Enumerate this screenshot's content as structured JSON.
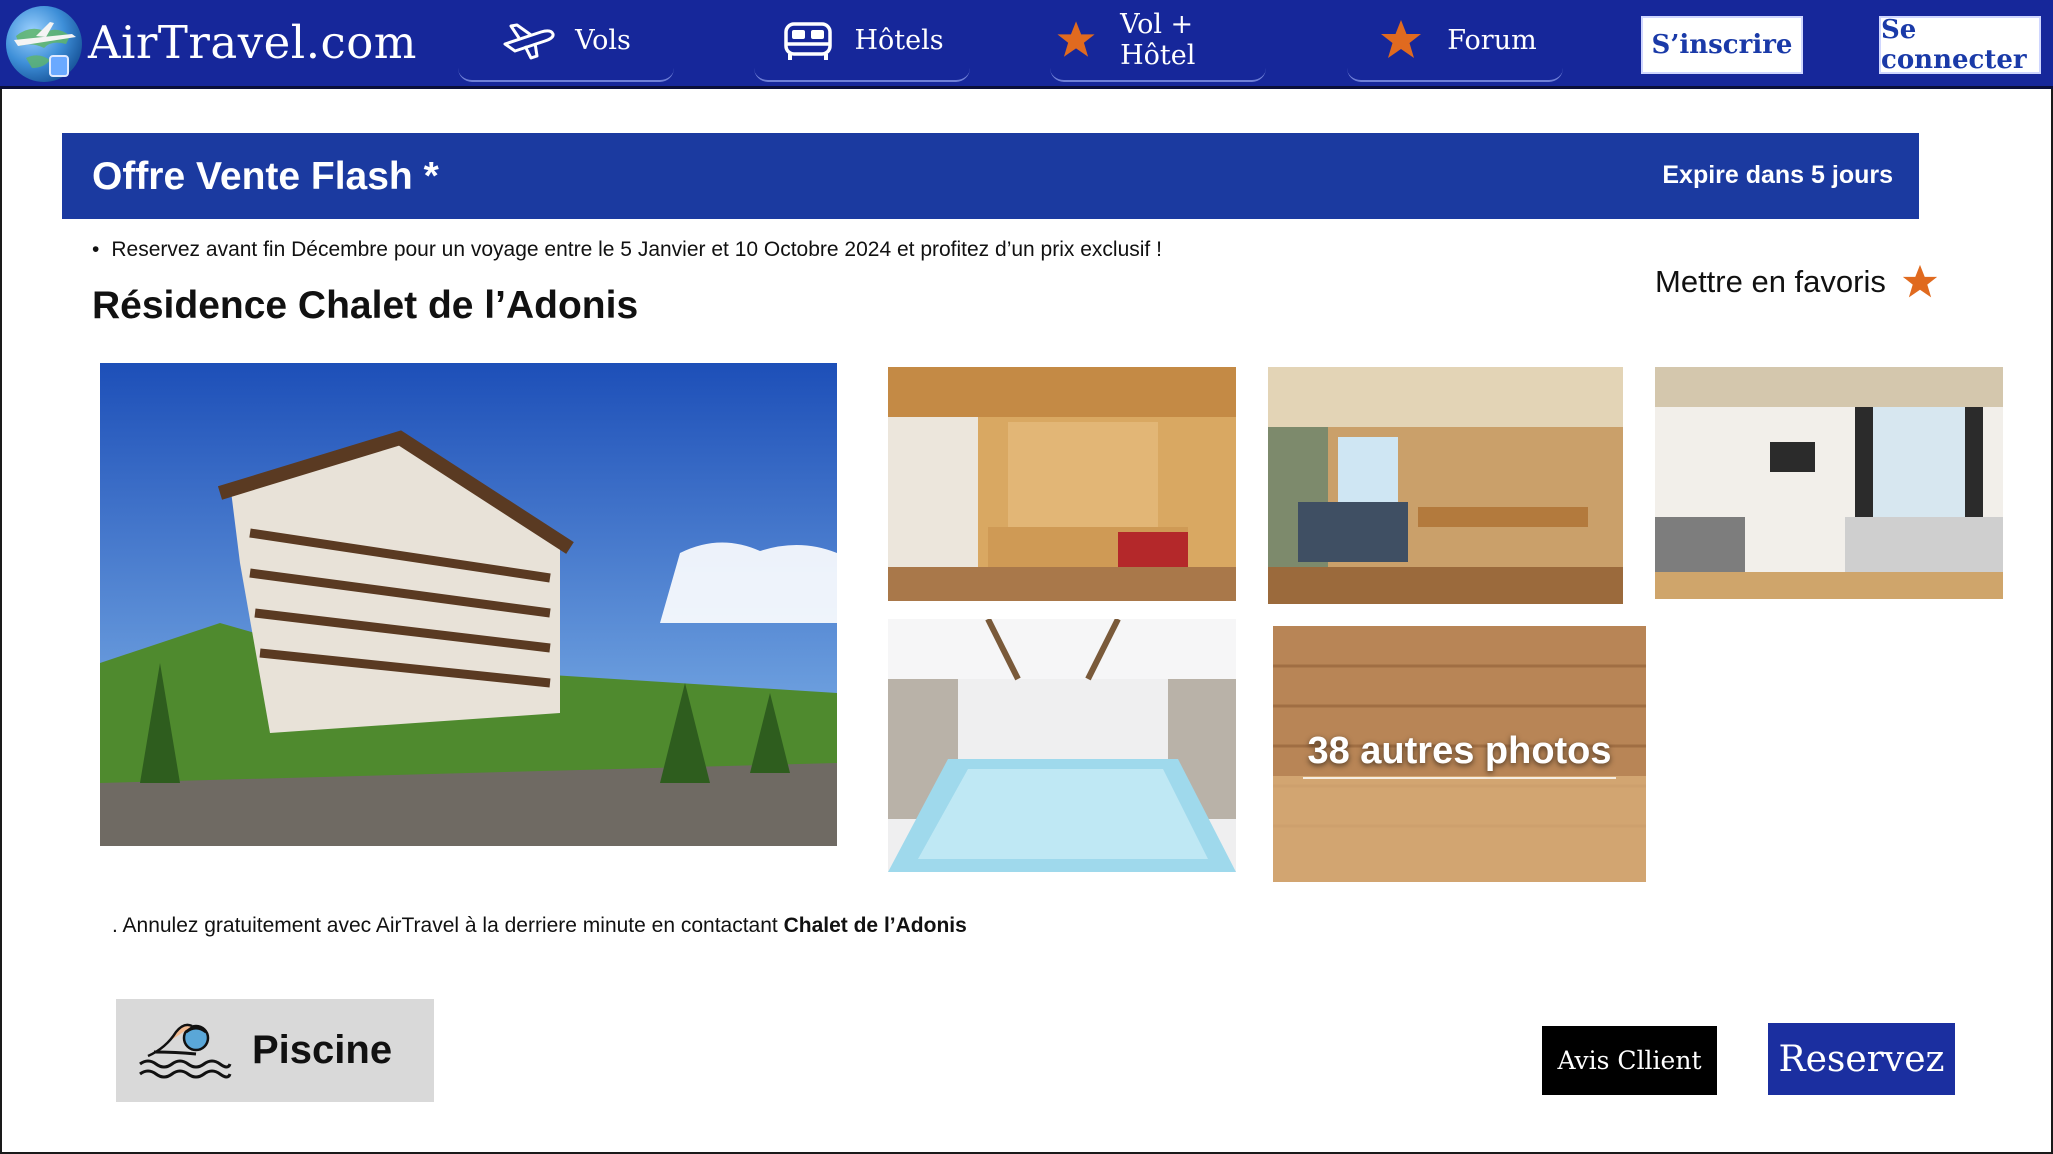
{
  "header": {
    "brand": "AirTravel.com",
    "nav": [
      {
        "label": "Vols",
        "icon": "plane-icon"
      },
      {
        "label": "Hôtels",
        "icon": "bed-icon"
      },
      {
        "label": "Vol + Hôtel",
        "icon": "star-icon"
      },
      {
        "label": "Forum",
        "icon": "star-icon"
      }
    ],
    "signup_label": "S’inscrire",
    "login_label": "Se connecter"
  },
  "offer": {
    "title": "Offre Vente Flash *",
    "expires": "Expire dans 5 jours",
    "bullet": "Reservez avant fin Décembre  pour un voyage  entre le 5 Janvier et  10  Octobre 2024 et profitez d’un prix exclusif !"
  },
  "property": {
    "name": "Résidence Chalet de l’Adonis",
    "favorite_label": "Mettre en favoris"
  },
  "gallery": {
    "more_photos": "38 autres photos"
  },
  "cancellation": {
    "text": ". Annulez gratuitement avec AirTravel à la derriere minute en contactant ",
    "contact": "Chalet de l’Adonis"
  },
  "amenity": {
    "label": "Piscine",
    "icon": "swimmer-icon"
  },
  "actions": {
    "reviews_label": "Avis Cllient",
    "book_label": "Reservez"
  },
  "colors": {
    "brand_blue": "#16279a",
    "banner_blue": "#1b3aa0",
    "star_orange": "#e06a1f",
    "amenity_gray": "#d9d9d9"
  }
}
